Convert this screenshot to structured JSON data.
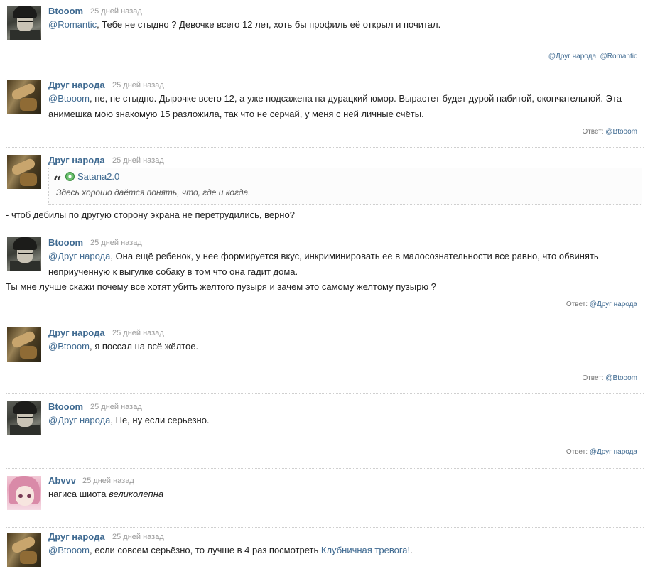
{
  "comments": [
    {
      "author": "Btooom",
      "date": "25 дней назад",
      "mention": "@Romantic",
      "text": ", Тебе не стыдно ? Девочке всего 12 лет, хоть бы профиль её открыл и почитал.",
      "footer_prefix": "",
      "footer_links": "@Друг народа, @Romantic"
    },
    {
      "author": "Друг народа",
      "date": "25 дней назад",
      "mention": "@Btooom",
      "text_line1": ", не, не стыдно. Дырочке всего 12, а уже подсажена на дурацкий юмор. Вырастет будет дурой набитой, окончательной. Эта",
      "text_line2": "анимешка мою знакомую 15 разложила, так что не серчай, у меня с ней личные счёты.",
      "reply_prefix": "Ответ: ",
      "reply_to": "@Btooom"
    },
    {
      "author": "Друг народа",
      "date": "25 дней назад",
      "quote_author": "Satana2.0",
      "quote_text": "Здесь хорошо даётся понять, что, где и когда.",
      "text": "- чтоб дебилы по другую сторону экрана не перетрудились, верно?"
    },
    {
      "author": "Btooom",
      "date": "25 дней назад",
      "mention": "@Друг народа",
      "text_line1": ", Она ещё ребенок, у нее формируется вкус, инкриминировать ее в малосознательности все равно, что обвинять",
      "text_line2": "неприученную к выгулке собаку в том что она гадит дома.",
      "text_line3": "Ты мне лучше скажи почему все хотят убить желтого пузыря и зачем это самому желтому пузырю ?",
      "reply_prefix": "Ответ: ",
      "reply_to": "@Друг народа"
    },
    {
      "author": "Друг народа",
      "date": "25 дней назад",
      "mention": "@Btooom",
      "text": ", я поссал на всё жёлтое.",
      "reply_prefix": "Ответ: ",
      "reply_to": "@Btooom"
    },
    {
      "author": "Btooom",
      "date": "25 дней назад",
      "mention": "@Друг народа",
      "text": ", Не, ну если серьезно.",
      "reply_prefix": "Ответ: ",
      "reply_to": "@Друг народа"
    },
    {
      "author": "Abvvv",
      "date": "25 дней назад",
      "text_plain": "нагиса шиота ",
      "text_italic": "великолепна"
    },
    {
      "author": "Друг народа",
      "date": "25 дней назад",
      "mention": "@Btooom",
      "text": ", если совсем серьёзно, то лучше в 4 раз посмотреть ",
      "link": "Клубничная тревога!",
      "text_end": "."
    }
  ]
}
